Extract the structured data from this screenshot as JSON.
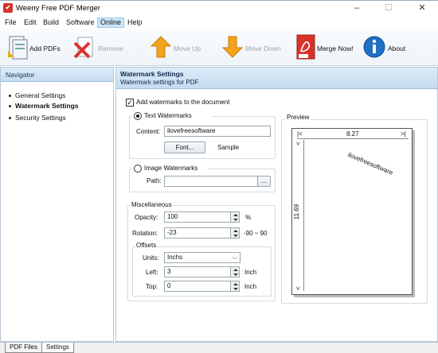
{
  "window": {
    "title": "Weeny Free PDF Merger",
    "minimize": "–",
    "maximize": "☐",
    "close": "✕"
  },
  "menu": [
    "File",
    "Edit",
    "Build",
    "Software",
    "Online",
    "Help"
  ],
  "toolbar": {
    "add_pdfs": "Add PDFs",
    "remove": "Remove",
    "move_up": "Move Up",
    "move_down": "Move Down",
    "merge_now": "Merge Now!",
    "about": "About"
  },
  "navigator": {
    "title": "Navigator",
    "items": [
      "General Settings",
      "Watermark Settings",
      "Security Settings"
    ]
  },
  "main": {
    "title": "Watermark Settings",
    "subtitle": "Watermark settings for PDF",
    "add_watermarks_label": "Add watermarks to the document",
    "add_watermarks_checked": true,
    "text_watermarks_label": "Text Watermarks",
    "content_label": "Content:",
    "content_value": "ilovefreesoftware",
    "font_button": "Font...",
    "sample_label": "Sample",
    "image_watermarks_label": "Image Watermarks",
    "path_label": "Path:",
    "path_value": "",
    "browse_button": "...",
    "misc_label": "Miscellaneous",
    "opacity_label": "Opacity:",
    "opacity_value": "100",
    "opacity_unit": "%",
    "rotation_label": "Rotation:",
    "rotation_value": "-23",
    "rotation_range": "-90 ~ 90",
    "offsets_label": "Offsets",
    "units_label": "Units:",
    "units_value": "Inchs",
    "left_label": "Left:",
    "left_value": "3",
    "left_unit": "Inch",
    "top_label": "Top:",
    "top_value": "0",
    "top_unit": "Inch"
  },
  "preview": {
    "title": "Preview",
    "width_value": "8.27",
    "height_value": "11.69",
    "watermark_text": "ilovefreesoftware",
    "arrow_left": "|<",
    "arrow_right": ">|",
    "arrow_top": "<",
    "arrow_bottom": "<"
  },
  "tabs": [
    "PDF Files",
    "Settings"
  ],
  "colors": {
    "accent": "#cde6f7",
    "header": "#c6dcf1",
    "merge_red": "#d7332b",
    "about_blue": "#1f6fc4"
  }
}
